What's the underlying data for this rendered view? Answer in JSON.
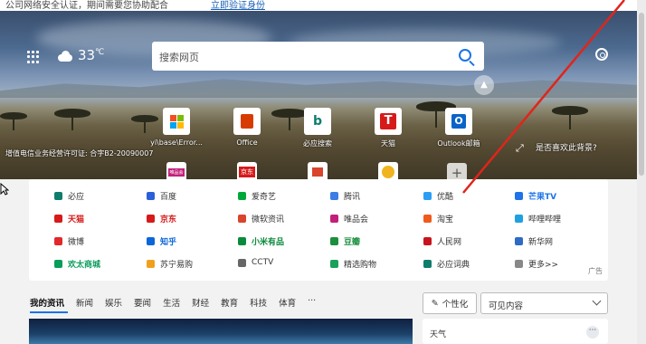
{
  "topbar": {
    "partial_text": "公司网络安全认证，期间需要您协助配合",
    "link_text": "立即验证身份"
  },
  "hero": {
    "temperature": "33",
    "temp_unit": "℃",
    "search_placeholder": "搜索网页",
    "license": "增值电信业务经营许可证: 合字B2-20090007",
    "like_background": "是否喜欢此背景?",
    "quick_tiles": [
      {
        "label": "yi\\base\\Error..."
      },
      {
        "label": "Office"
      },
      {
        "label": "必应搜索"
      },
      {
        "label": "天猫"
      },
      {
        "label": "Outlook邮箱"
      }
    ],
    "pinned_labels": [
      "唯品会",
      "京东"
    ]
  },
  "links": {
    "rows": [
      [
        {
          "label": "必应",
          "color": "#0f7d6b",
          "bold": false
        },
        {
          "label": "百度",
          "color": "#2b5fd9",
          "bold": false
        },
        {
          "label": "爱奇艺",
          "color": "#00a83c",
          "bold": false
        },
        {
          "label": "腾讯",
          "color": "#3c7de6",
          "bold": false
        },
        {
          "label": "优酷",
          "color": "#2b9ef4",
          "bold": false
        },
        {
          "label": "芒果TV",
          "color": "#1e73e8",
          "bold": true
        }
      ],
      [
        {
          "label": "天猫",
          "color": "#d61a1a",
          "bold": true
        },
        {
          "label": "京东",
          "color": "#d61a1a",
          "bold": true
        },
        {
          "label": "微软资讯",
          "color": "#d9442c",
          "bold": false
        },
        {
          "label": "唯品会",
          "color": "#c21f7a",
          "bold": false
        },
        {
          "label": "淘宝",
          "color": "#f05a1a",
          "bold": false
        },
        {
          "label": "哔哩哔哩",
          "color": "#20a0e0",
          "bold": false
        }
      ],
      [
        {
          "label": "微博",
          "color": "#e2282a",
          "bold": false
        },
        {
          "label": "知乎",
          "color": "#0a66d9",
          "bold": true
        },
        {
          "label": "小米有品",
          "color": "#0a8a3c",
          "bold": true
        },
        {
          "label": "豆瓣",
          "color": "#1a8f3e",
          "bold": true
        },
        {
          "label": "人民网",
          "color": "#c8141e",
          "bold": false
        },
        {
          "label": "新华网",
          "color": "#2d6bc6",
          "bold": false
        }
      ],
      [
        {
          "label": "欢太商城",
          "color": "#0a9c5a",
          "bold": true
        },
        {
          "label": "苏宁易购",
          "color": "#f0a01e",
          "bold": false
        },
        {
          "label": "CCTV",
          "color": "#666666",
          "bold": false
        },
        {
          "label": "精选购物",
          "color": "#1aa05a",
          "bold": false
        },
        {
          "label": "必应词典",
          "color": "#0f7d6b",
          "bold": false
        },
        {
          "label": "更多>>",
          "color": "#888888",
          "bold": false
        }
      ]
    ],
    "ad_label": "广告"
  },
  "news": {
    "tabs": [
      "我的资讯",
      "新闻",
      "娱乐",
      "要闻",
      "生活",
      "财经",
      "教育",
      "科技",
      "体育",
      "···"
    ],
    "personalize_label": "个性化",
    "visible_content_label": "可见内容",
    "weather_card_title": "天气",
    "weather_card_more": "···"
  }
}
